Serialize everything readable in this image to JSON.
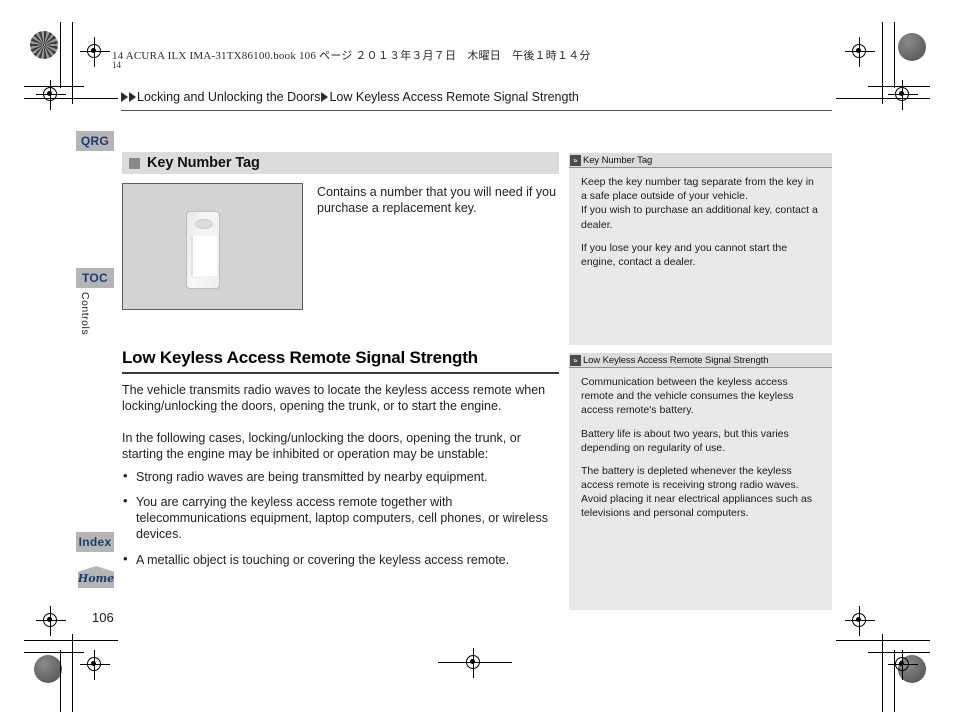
{
  "print_header": "14 ACURA ILX IMA-31TX86100.book   106 ページ   ２０１３年３月７日　木曜日　午後１時１４分",
  "corner_mark_number": "14",
  "breadcrumb": {
    "items": [
      {
        "label": "Locking and Unlocking the Doors",
        "arrows": 2
      },
      {
        "label": "Low Keyless Access Remote Signal Strength",
        "arrows": 1
      }
    ]
  },
  "sidebar_tabs": {
    "qrg": "QRG",
    "toc": "TOC",
    "index": "Index",
    "home": "Home",
    "chapter_label": "Controls"
  },
  "main": {
    "section": {
      "title": "Key Number Tag",
      "figure_caption": "Contains a number that you will need if you purchase a replacement key."
    },
    "article": {
      "title": "Low Keyless Access Remote Signal Strength",
      "intro": "The vehicle transmits radio waves to locate the keyless access remote when locking/unlocking the doors, opening the trunk, or to start the engine.",
      "lead_in": "In the following cases, locking/unlocking the doors, opening the trunk, or starting the engine may be inhibited or operation may be unstable:",
      "bullets": [
        "Strong radio waves are being transmitted by nearby equipment.",
        "You are carrying the keyless access remote together with telecommunications equipment, laptop computers, cell phones, or wireless devices.",
        "A metallic object is touching or covering the keyless access remote."
      ]
    }
  },
  "info_panels": [
    {
      "heading": "Key Number Tag",
      "paragraphs": [
        "Keep the key number tag separate from the key in a safe place outside of your vehicle.",
        "If you wish to purchase an additional key, contact a dealer.",
        "If you lose your key and you cannot start the engine, contact a dealer."
      ]
    },
    {
      "heading": "Low Keyless Access Remote Signal Strength",
      "paragraphs": [
        "Communication between the keyless access remote and the vehicle consumes the keyless access remote's battery.",
        "Battery life is about two years, but this varies depending on regularity of use.",
        "The battery is depleted whenever the keyless access remote is receiving strong radio waves. Avoid placing it near electrical appliances such as televisions and personal computers."
      ]
    }
  ],
  "page_number": "106",
  "colors": {
    "tab_gray": "#b5b5b5",
    "tab_text_blue": "#1d3c6e",
    "banner_gray": "#dcdcdc",
    "panel_gray": "#e9e9e9",
    "panel_head_gray": "#dddddd",
    "figure_gray": "#d3d3d3"
  }
}
